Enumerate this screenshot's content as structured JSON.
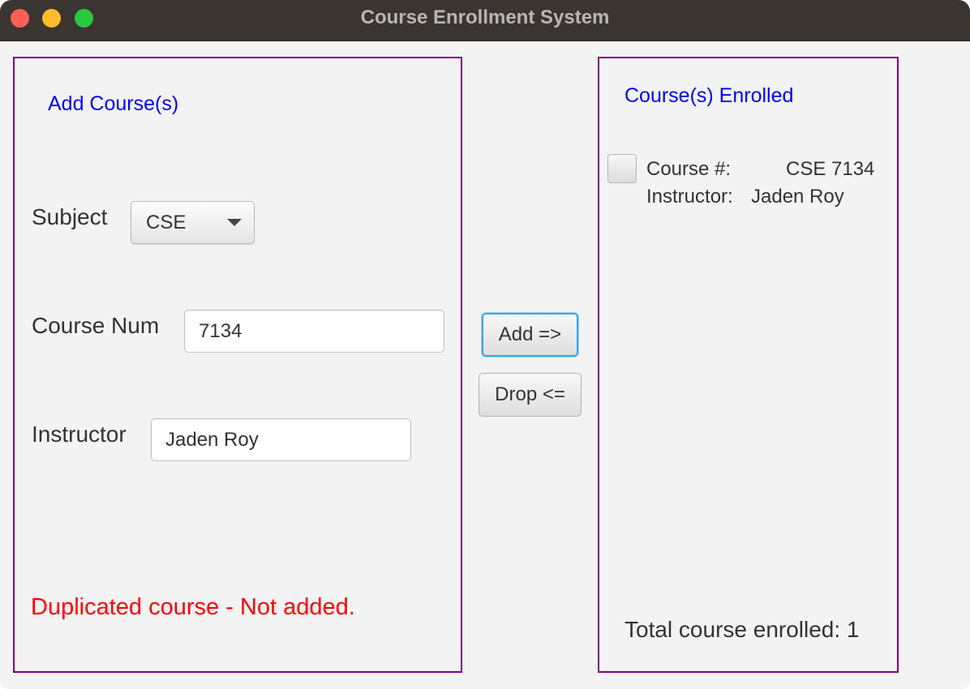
{
  "window": {
    "title": "Course Enrollment System"
  },
  "add_panel": {
    "heading": "Add Course(s)",
    "subject_label": "Subject",
    "subject_value": "CSE",
    "course_num_label": "Course Num",
    "course_num_value": "7134",
    "instructor_label": "Instructor",
    "instructor_value": "Jaden Roy",
    "error_message": "Duplicated course - Not added."
  },
  "buttons": {
    "add_label": "Add =>",
    "drop_label": "Drop <="
  },
  "enrolled_panel": {
    "heading": "Course(s) Enrolled",
    "courses": [
      {
        "course_label": "Course #:",
        "course_value": "CSE 7134",
        "instructor_label": "Instructor:",
        "instructor_value": "Jaden Roy",
        "checked": false
      }
    ],
    "total_text": "Total course enrolled: 1"
  },
  "colors": {
    "panel_border": "#800080",
    "heading": "#0000ff",
    "error": "#ff0000",
    "titlebar": "#3b3532",
    "focus_ring": "#3aa6e8"
  }
}
